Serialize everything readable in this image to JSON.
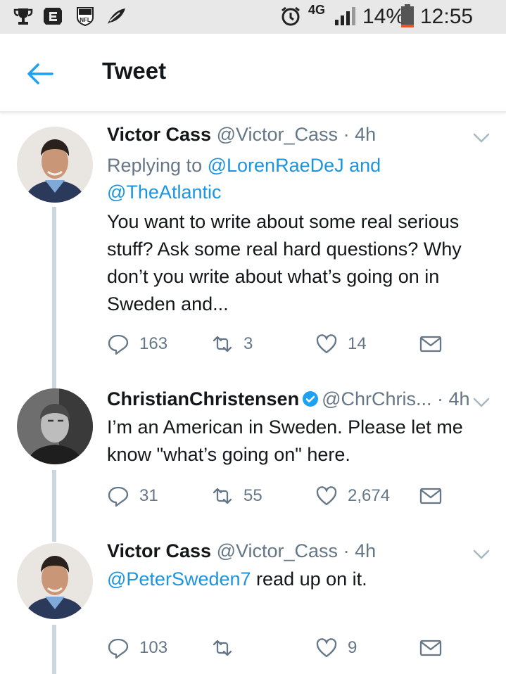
{
  "status_bar": {
    "network": "4G",
    "battery_percent": "14%",
    "time": "12:55 PM",
    "battery_level": 0.14,
    "colors": {
      "battery_low": "#e4572e"
    }
  },
  "header": {
    "title": "Tweet",
    "back_icon": "arrow-left-icon"
  },
  "colors": {
    "accent": "#1da1f2",
    "link": "#1b95e0",
    "muted": "#657786",
    "thread": "#ccd6dd"
  },
  "tweets": [
    {
      "name": "Victor Cass",
      "handle": "@Victor_Cass",
      "sep": "·",
      "time": "4h",
      "replying_prefix": "Replying to",
      "replying_user1": "@LorenRaeDeJ",
      "replying_and": "and",
      "replying_user2": "@TheAtlantic",
      "text": "You want to write about some real serious stuff? Ask some real hard questions? Why don’t you write about what’s going on in Sweden and...",
      "replies": "163",
      "retweets": "3",
      "likes": "14"
    },
    {
      "name": "ChristianChristensen",
      "verified": true,
      "handle": "@ChrChris...",
      "sep": "·",
      "time": "4h",
      "text": "I’m an American in Sweden. Please let me know \"what’s going on\" here.",
      "replies": "31",
      "retweets": "55",
      "likes": "2,674"
    },
    {
      "name": "Victor Cass",
      "handle": "@Victor_Cass",
      "sep": "·",
      "time": "4h",
      "mention": "@PeterSweden7",
      "text": "read up on it.",
      "replies": "103",
      "retweets": "",
      "likes": "9"
    }
  ]
}
